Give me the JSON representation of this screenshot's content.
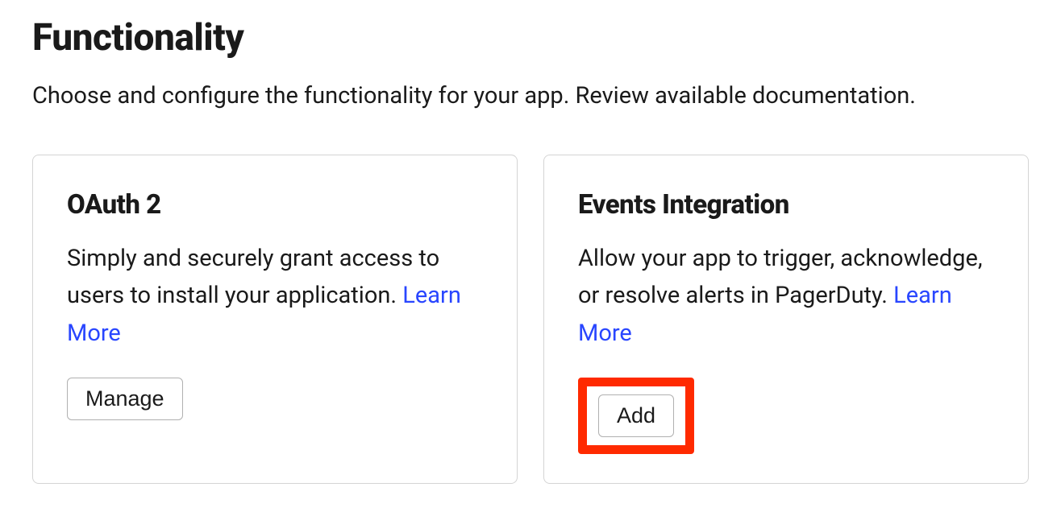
{
  "header": {
    "title": "Functionality",
    "subtitle": "Choose and configure the functionality for your app. Review available documentation."
  },
  "cards": {
    "oauth": {
      "title": "OAuth 2",
      "description": "Simply and securely grant access to users to install your application. ",
      "learn_more": "Learn More",
      "button": "Manage"
    },
    "events": {
      "title": "Events Integration",
      "description": "Allow your app to trigger, acknowledge, or resolve alerts in PagerDuty. ",
      "learn_more": "Learn More",
      "button": "Add"
    }
  }
}
